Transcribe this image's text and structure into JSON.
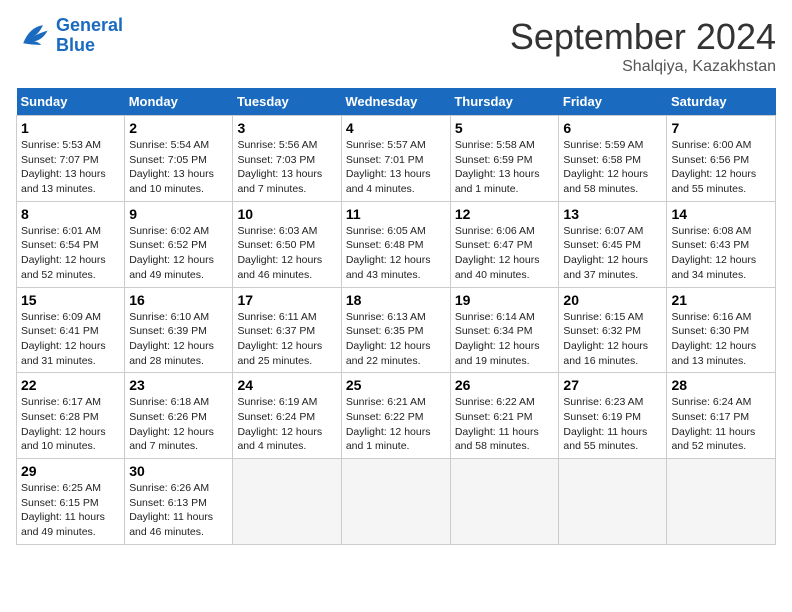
{
  "header": {
    "logo_text_general": "General",
    "logo_text_blue": "Blue",
    "month_title": "September 2024",
    "location": "Shalqiya, Kazakhstan"
  },
  "weekdays": [
    "Sunday",
    "Monday",
    "Tuesday",
    "Wednesday",
    "Thursday",
    "Friday",
    "Saturday"
  ],
  "weeks": [
    [
      {
        "day": "1",
        "info": "Sunrise: 5:53 AM\nSunset: 7:07 PM\nDaylight: 13 hours\nand 13 minutes."
      },
      {
        "day": "2",
        "info": "Sunrise: 5:54 AM\nSunset: 7:05 PM\nDaylight: 13 hours\nand 10 minutes."
      },
      {
        "day": "3",
        "info": "Sunrise: 5:56 AM\nSunset: 7:03 PM\nDaylight: 13 hours\nand 7 minutes."
      },
      {
        "day": "4",
        "info": "Sunrise: 5:57 AM\nSunset: 7:01 PM\nDaylight: 13 hours\nand 4 minutes."
      },
      {
        "day": "5",
        "info": "Sunrise: 5:58 AM\nSunset: 6:59 PM\nDaylight: 13 hours\nand 1 minute."
      },
      {
        "day": "6",
        "info": "Sunrise: 5:59 AM\nSunset: 6:58 PM\nDaylight: 12 hours\nand 58 minutes."
      },
      {
        "day": "7",
        "info": "Sunrise: 6:00 AM\nSunset: 6:56 PM\nDaylight: 12 hours\nand 55 minutes."
      }
    ],
    [
      {
        "day": "8",
        "info": "Sunrise: 6:01 AM\nSunset: 6:54 PM\nDaylight: 12 hours\nand 52 minutes."
      },
      {
        "day": "9",
        "info": "Sunrise: 6:02 AM\nSunset: 6:52 PM\nDaylight: 12 hours\nand 49 minutes."
      },
      {
        "day": "10",
        "info": "Sunrise: 6:03 AM\nSunset: 6:50 PM\nDaylight: 12 hours\nand 46 minutes."
      },
      {
        "day": "11",
        "info": "Sunrise: 6:05 AM\nSunset: 6:48 PM\nDaylight: 12 hours\nand 43 minutes."
      },
      {
        "day": "12",
        "info": "Sunrise: 6:06 AM\nSunset: 6:47 PM\nDaylight: 12 hours\nand 40 minutes."
      },
      {
        "day": "13",
        "info": "Sunrise: 6:07 AM\nSunset: 6:45 PM\nDaylight: 12 hours\nand 37 minutes."
      },
      {
        "day": "14",
        "info": "Sunrise: 6:08 AM\nSunset: 6:43 PM\nDaylight: 12 hours\nand 34 minutes."
      }
    ],
    [
      {
        "day": "15",
        "info": "Sunrise: 6:09 AM\nSunset: 6:41 PM\nDaylight: 12 hours\nand 31 minutes."
      },
      {
        "day": "16",
        "info": "Sunrise: 6:10 AM\nSunset: 6:39 PM\nDaylight: 12 hours\nand 28 minutes."
      },
      {
        "day": "17",
        "info": "Sunrise: 6:11 AM\nSunset: 6:37 PM\nDaylight: 12 hours\nand 25 minutes."
      },
      {
        "day": "18",
        "info": "Sunrise: 6:13 AM\nSunset: 6:35 PM\nDaylight: 12 hours\nand 22 minutes."
      },
      {
        "day": "19",
        "info": "Sunrise: 6:14 AM\nSunset: 6:34 PM\nDaylight: 12 hours\nand 19 minutes."
      },
      {
        "day": "20",
        "info": "Sunrise: 6:15 AM\nSunset: 6:32 PM\nDaylight: 12 hours\nand 16 minutes."
      },
      {
        "day": "21",
        "info": "Sunrise: 6:16 AM\nSunset: 6:30 PM\nDaylight: 12 hours\nand 13 minutes."
      }
    ],
    [
      {
        "day": "22",
        "info": "Sunrise: 6:17 AM\nSunset: 6:28 PM\nDaylight: 12 hours\nand 10 minutes."
      },
      {
        "day": "23",
        "info": "Sunrise: 6:18 AM\nSunset: 6:26 PM\nDaylight: 12 hours\nand 7 minutes."
      },
      {
        "day": "24",
        "info": "Sunrise: 6:19 AM\nSunset: 6:24 PM\nDaylight: 12 hours\nand 4 minutes."
      },
      {
        "day": "25",
        "info": "Sunrise: 6:21 AM\nSunset: 6:22 PM\nDaylight: 12 hours\nand 1 minute."
      },
      {
        "day": "26",
        "info": "Sunrise: 6:22 AM\nSunset: 6:21 PM\nDaylight: 11 hours\nand 58 minutes."
      },
      {
        "day": "27",
        "info": "Sunrise: 6:23 AM\nSunset: 6:19 PM\nDaylight: 11 hours\nand 55 minutes."
      },
      {
        "day": "28",
        "info": "Sunrise: 6:24 AM\nSunset: 6:17 PM\nDaylight: 11 hours\nand 52 minutes."
      }
    ],
    [
      {
        "day": "29",
        "info": "Sunrise: 6:25 AM\nSunset: 6:15 PM\nDaylight: 11 hours\nand 49 minutes."
      },
      {
        "day": "30",
        "info": "Sunrise: 6:26 AM\nSunset: 6:13 PM\nDaylight: 11 hours\nand 46 minutes."
      },
      {
        "day": "",
        "info": ""
      },
      {
        "day": "",
        "info": ""
      },
      {
        "day": "",
        "info": ""
      },
      {
        "day": "",
        "info": ""
      },
      {
        "day": "",
        "info": ""
      }
    ]
  ]
}
